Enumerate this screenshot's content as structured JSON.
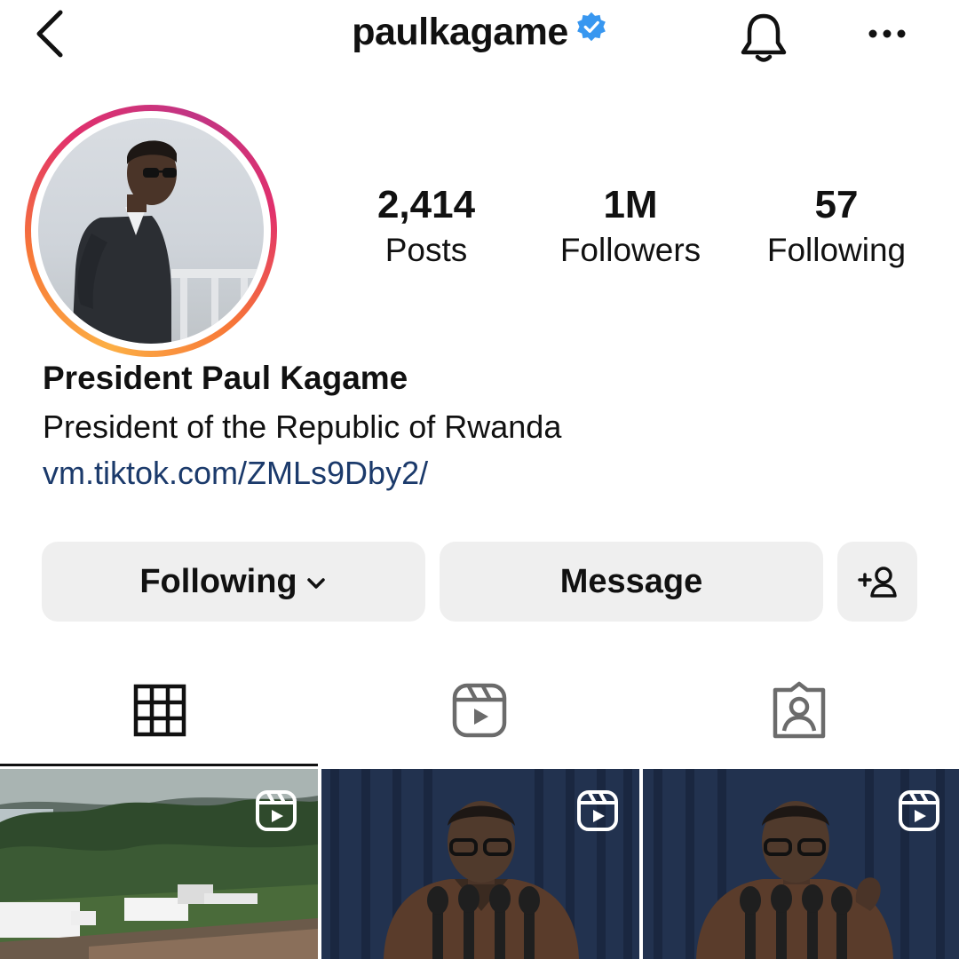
{
  "header": {
    "username": "paulkagame",
    "verified": true,
    "icons": [
      "back-arrow-icon",
      "verified-badge-icon",
      "bell-icon",
      "more-options-icon"
    ]
  },
  "profile": {
    "stats": {
      "posts_count": "2,414",
      "posts_label": "Posts",
      "followers_count": "1M",
      "followers_label": "Followers",
      "following_count": "57",
      "following_label": "Following"
    },
    "display_name": "President Paul Kagame",
    "bio": "President of the Republic of Rwanda",
    "link": "vm.tiktok.com/ZMLs9Dby2/"
  },
  "actions": {
    "following_label": "Following",
    "message_label": "Message",
    "add_user_icon": "add-person-icon"
  },
  "tabs": [
    {
      "name": "grid",
      "icon": "grid-icon",
      "active": true
    },
    {
      "name": "reels",
      "icon": "reels-icon",
      "active": false
    },
    {
      "name": "tagged",
      "icon": "tagged-icon",
      "active": false
    }
  ],
  "posts": [
    {
      "type": "reel",
      "icon": "reel-icon"
    },
    {
      "type": "reel",
      "icon": "reel-icon"
    },
    {
      "type": "reel",
      "icon": "reel-icon"
    }
  ],
  "colors": {
    "link": "#1b3a6b",
    "verified": "#3897f0",
    "button_bg": "#efefef",
    "ring_gradient": [
      "#fcaf45",
      "#f77737",
      "#e1306c",
      "#c13584"
    ]
  }
}
